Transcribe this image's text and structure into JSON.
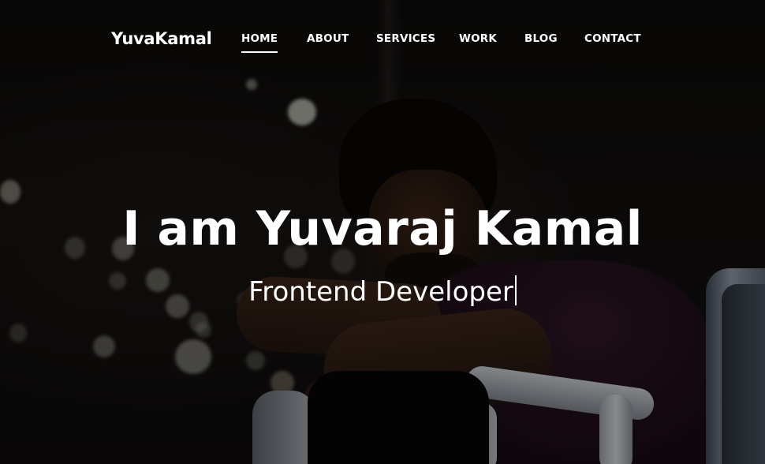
{
  "brand": {
    "name": "YuvaKamal"
  },
  "nav": {
    "items": [
      {
        "label": "HOME",
        "active": true
      },
      {
        "label": "ABOUT",
        "active": false
      },
      {
        "label": "SERVICES",
        "active": false
      },
      {
        "label": "WORK",
        "active": false
      },
      {
        "label": "BLOG",
        "active": false
      },
      {
        "label": "CONTACT",
        "active": false
      }
    ]
  },
  "hero": {
    "title": "I am Yuvaraj Kamal",
    "subtitle": "Frontend Developer",
    "typing_cursor": "|"
  },
  "colors": {
    "text": "#ffffff",
    "background": "#0b0a0a",
    "shirt": "#2a1523",
    "railing": "#c8ccd2"
  }
}
